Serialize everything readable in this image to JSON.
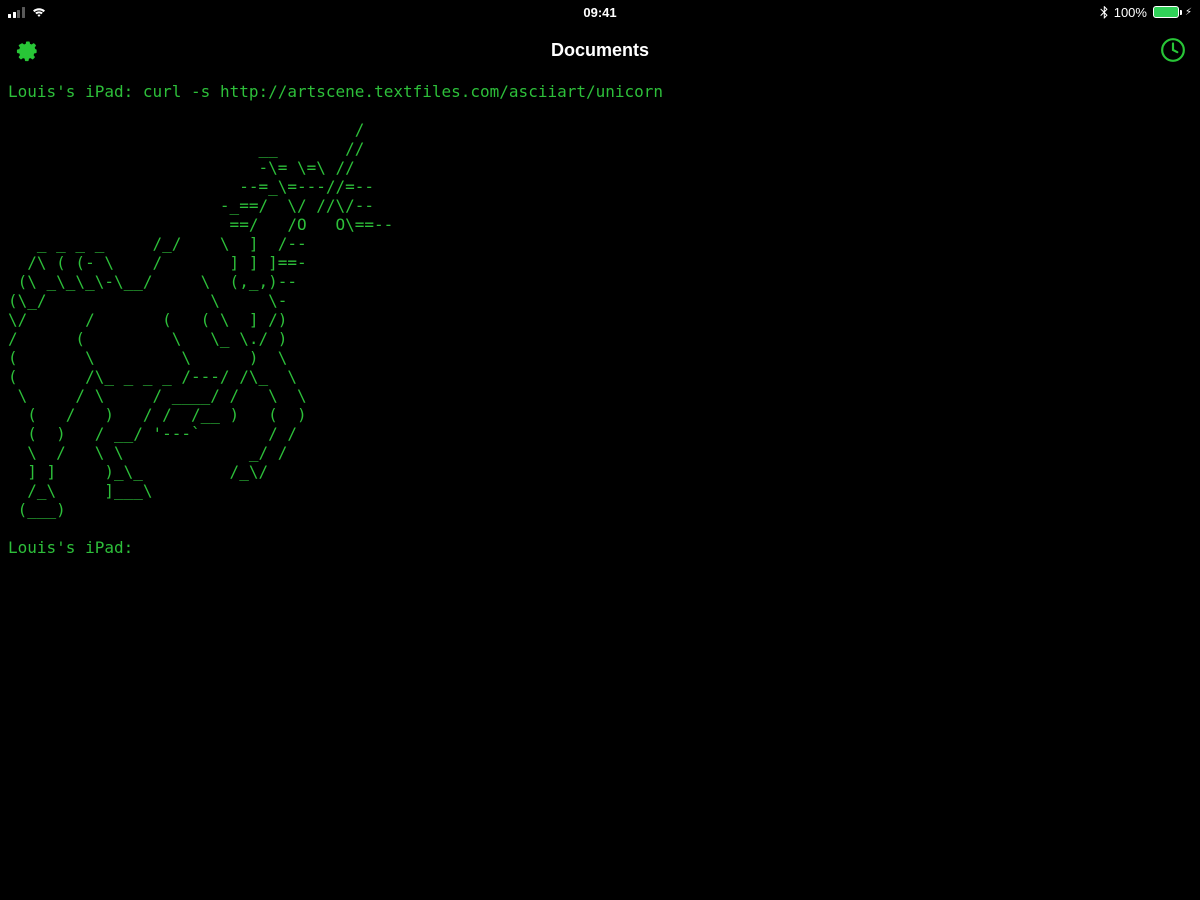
{
  "status": {
    "time": "09:41",
    "battery_pct": "100%"
  },
  "nav": {
    "title": "Documents"
  },
  "terminal": {
    "prompt": "Louis's iPad:",
    "command": "curl -s http://artscene.textfiles.com/asciiart/unicorn",
    "output": "\n                                    /\n                          __       //\n                          -\\= \\=\\ //\n                        --=_\\=---//=--\n                      -_==/  \\/ //\\/--\n                       ==/   /O   O\\==--\n   _ _ _ _     /_/    \\  ]  /--\n  /\\ ( (- \\    /       ] ] ]==-\n (\\ _\\_\\_\\-\\__/     \\  (,_,)--\n(\\_/                 \\     \\-\n\\/      /       (   ( \\  ] /)\n/      (         \\   \\_ \\./ )\n(       \\         \\      )  \\\n(       /\\_ _ _ _ /---/ /\\_  \\\n \\     / \\     / ____/ /   \\  \\\n  (   /   )   / /  /__ )   (  )\n  (  )   / __/ '---`       / /\n  \\  /   \\ \\             _/ /\n  ] ]     )_\\_         /_\\/\n  /_\\     ]___\\\n (___)\n"
  }
}
